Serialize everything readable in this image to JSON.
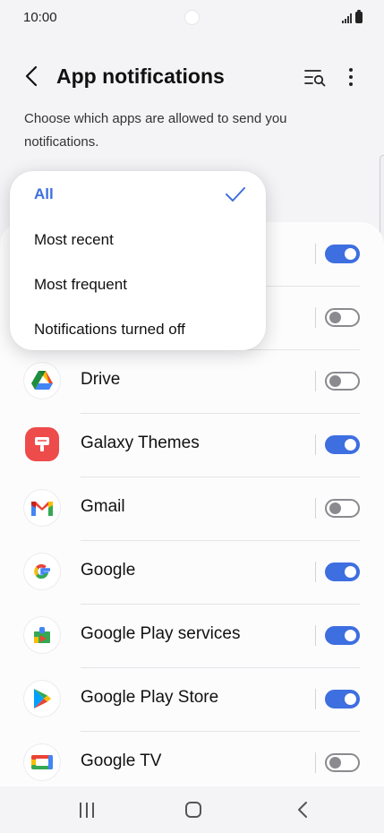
{
  "status_bar": {
    "time": "10:00"
  },
  "header": {
    "title": "App notifications"
  },
  "subtitle": "Choose which apps are allowed to send you notifications.",
  "menu": {
    "items": [
      {
        "label": "All",
        "selected": true
      },
      {
        "label": "Most recent",
        "selected": false
      },
      {
        "label": "Most frequent",
        "selected": false
      },
      {
        "label": "Notifications turned off",
        "selected": false
      }
    ]
  },
  "apps": [
    {
      "name": "",
      "enabled": true,
      "icon": "hidden-app-icon"
    },
    {
      "name": "",
      "enabled": false,
      "icon": "hidden-app-icon"
    },
    {
      "name": "Drive",
      "enabled": false,
      "icon": "drive-icon"
    },
    {
      "name": "Galaxy Themes",
      "enabled": true,
      "icon": "galaxy-themes-icon"
    },
    {
      "name": "Gmail",
      "enabled": false,
      "icon": "gmail-icon"
    },
    {
      "name": "Google",
      "enabled": true,
      "icon": "google-icon"
    },
    {
      "name": "Google Play services",
      "enabled": true,
      "icon": "google-play-services-icon"
    },
    {
      "name": "Google Play Store",
      "enabled": true,
      "icon": "google-play-store-icon"
    },
    {
      "name": "Google TV",
      "enabled": false,
      "icon": "google-tv-icon"
    }
  ],
  "colors": {
    "accent": "#3e6fe0",
    "toggle_off": "#8a8a8f",
    "background": "#f4f4f6"
  }
}
